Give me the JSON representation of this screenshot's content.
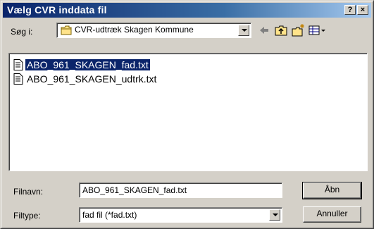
{
  "window": {
    "title": "Vælg CVR inddata fil",
    "help_label": "?",
    "close_label": "×"
  },
  "lookin": {
    "label": "Søg i:",
    "value": "CVR-udtræk Skagen Kommune"
  },
  "toolbar": {
    "icons": [
      "back-arrow-icon",
      "up-folder-icon",
      "new-folder-icon",
      "view-menu-icon"
    ]
  },
  "files": [
    {
      "name": "ABO_961_SKAGEN_fad.txt",
      "selected": true
    },
    {
      "name": "ABO_961_SKAGEN_udtrk.txt",
      "selected": false
    }
  ],
  "filename": {
    "label": "Filnavn:",
    "value": "ABO_961_SKAGEN_fad.txt"
  },
  "filetype": {
    "label": "Filtype:",
    "value": "fad fil (*fad.txt)"
  },
  "buttons": {
    "open": "Åbn",
    "cancel": "Annuller"
  },
  "colors": {
    "title_bar": "#0a246a",
    "selection": "#0a246a",
    "face": "#d4d0c8"
  }
}
